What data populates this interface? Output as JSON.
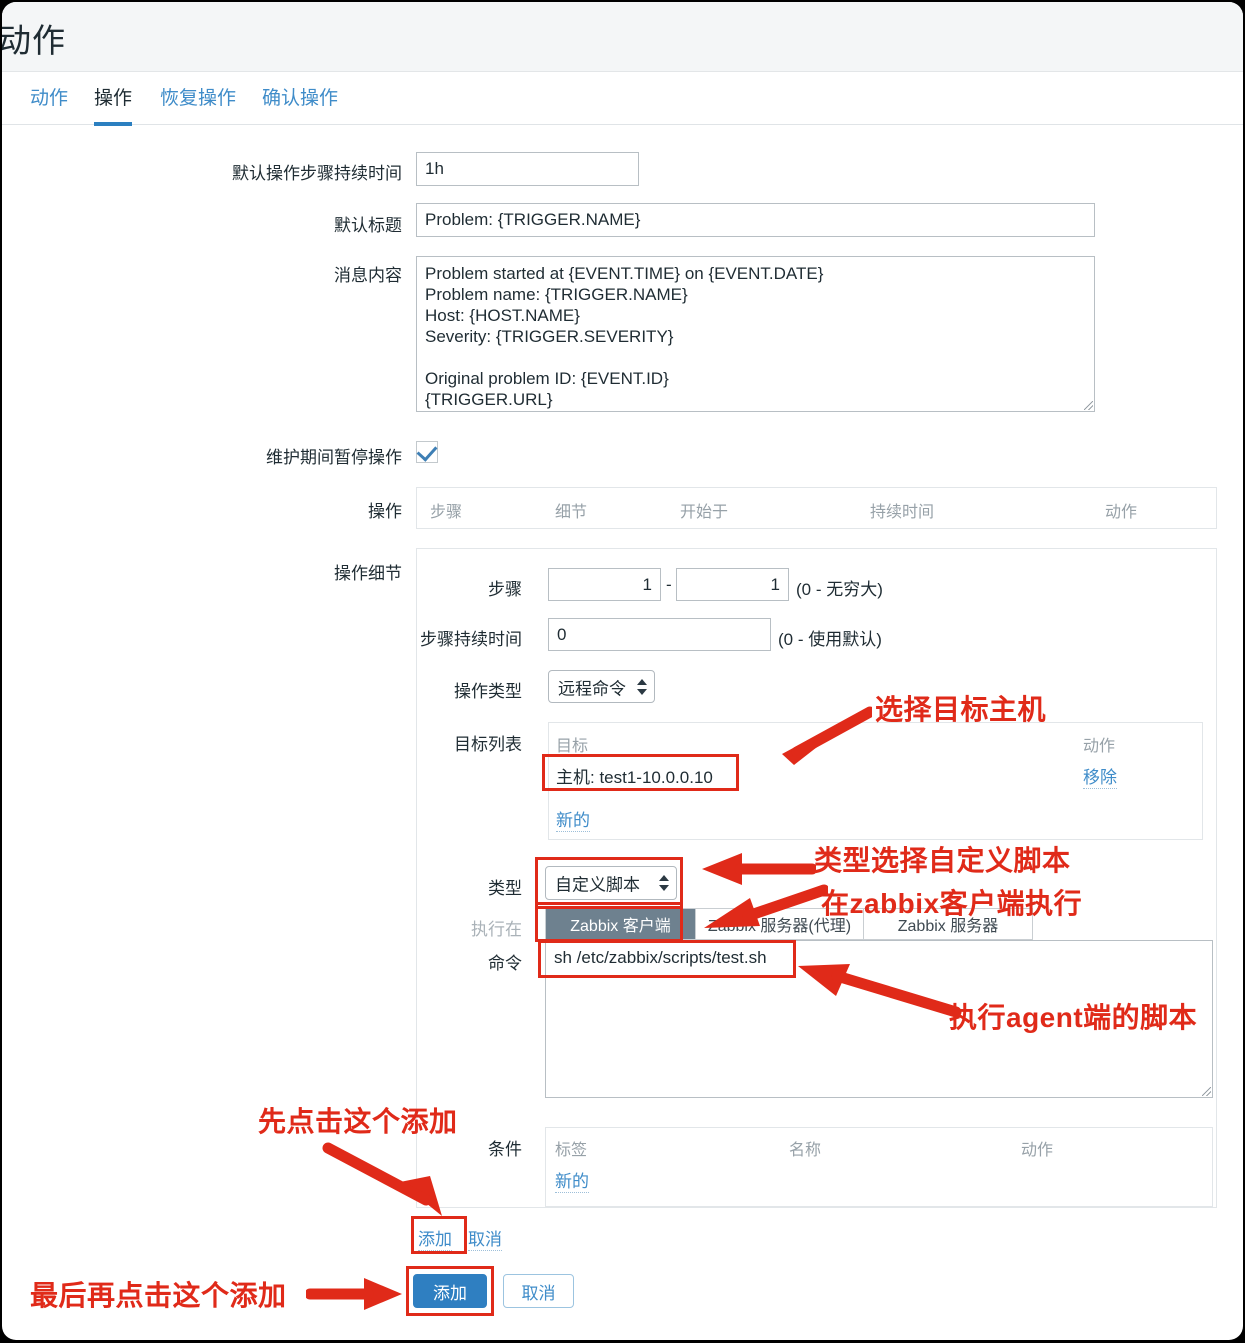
{
  "dialog": {
    "title": "动作"
  },
  "tabs": [
    {
      "label": "动作",
      "active": false
    },
    {
      "label": "操作",
      "active": true
    },
    {
      "label": "恢复操作",
      "active": false
    },
    {
      "label": "确认操作",
      "active": false
    }
  ],
  "form": {
    "default_step_duration_label": "默认操作步骤持续时间",
    "default_step_duration_value": "1h",
    "default_subject_label": "默认标题",
    "default_subject_value": "Problem: {TRIGGER.NAME}",
    "message_label": "消息内容",
    "message_value": "Problem started at {EVENT.TIME} on {EVENT.DATE}\nProblem name: {TRIGGER.NAME}\nHost: {HOST.NAME}\nSeverity: {TRIGGER.SEVERITY}\n\nOriginal problem ID: {EVENT.ID}\n{TRIGGER.URL}",
    "pause_maintenance_label": "维护期间暂停操作",
    "pause_maintenance_checked": true
  },
  "operations_table": {
    "label": "操作",
    "headers": [
      "步骤",
      "细节",
      "开始于",
      "持续时间",
      "动作"
    ]
  },
  "operation_details": {
    "label": "操作细节",
    "steps_label": "步骤",
    "steps_from": "1",
    "steps_to": "1",
    "steps_hint": "(0 - 无穷大)",
    "step_duration_label": "步骤持续时间",
    "step_duration_value": "0",
    "step_duration_hint": "(0 - 使用默认)",
    "operation_type_label": "操作类型",
    "operation_type_value": "远程命令",
    "target_list_label": "目标列表",
    "target_list_headers": [
      "目标",
      "动作"
    ],
    "target_row_value": "主机: test1-10.0.0.10",
    "target_row_action": "移除",
    "target_new_link": "新的",
    "type_label": "类型",
    "type_value": "自定义脚本",
    "execute_on_label": "执行在",
    "execute_on_options": [
      "Zabbix 客户端",
      "Zabbix 服务器(代理)",
      "Zabbix 服务器"
    ],
    "execute_on_selected": "Zabbix 客户端",
    "command_label": "命令",
    "command_value": "sh /etc/zabbix/scripts/test.sh",
    "conditions_label": "条件",
    "conditions_headers": [
      "标签",
      "名称",
      "动作"
    ],
    "conditions_new_link": "新的",
    "inner_add_link": "添加",
    "inner_cancel_link": "取消"
  },
  "footer": {
    "add_label": "添加",
    "cancel_label": "取消"
  },
  "annotations": [
    {
      "id": "select-target-host",
      "text": "选择目标主机"
    },
    {
      "id": "type-custom-script",
      "text": "类型选择自定义脚本"
    },
    {
      "id": "execute-on-zabbix-agent",
      "text": "在zabbix客户端执行"
    },
    {
      "id": "run-agent-script",
      "text": "执行agent端的脚本"
    },
    {
      "id": "click-add-first",
      "text": "先点击这个添加"
    },
    {
      "id": "click-add-last",
      "text": "最后再点击这个添加"
    }
  ],
  "colors": {
    "accent": "#2f7fc1",
    "link": "#3f8cc9",
    "annotation": "#e02a19",
    "selected_segment": "#6e818f"
  }
}
